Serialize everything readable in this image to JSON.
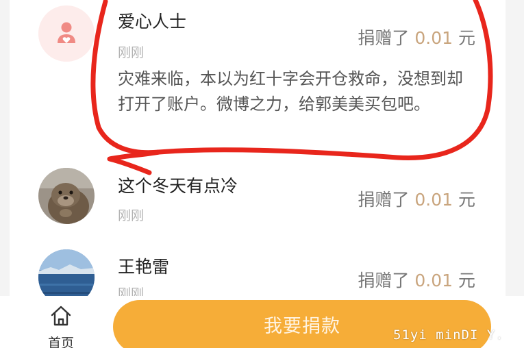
{
  "donations": [
    {
      "name": "爱心人士",
      "time": "刚刚",
      "donated_label": "捐赠了",
      "amount": "0.01",
      "currency": "元",
      "message": "灾难来临，本以为红十字会开仓救命，没想到却打开了账户。微博之力，给郭美美买包吧。",
      "avatar_icon": "user-heart-icon"
    },
    {
      "name": "这个冬天有点冷",
      "time": "刚刚",
      "donated_label": "捐赠了",
      "amount": "0.01",
      "currency": "元",
      "avatar_icon": "otter-photo"
    },
    {
      "name": "王艳雷",
      "time": "刚刚",
      "donated_label": "捐赠了",
      "amount": "0.01",
      "currency": "元",
      "avatar_icon": "sea-landscape-photo"
    }
  ],
  "bottom_nav": {
    "home_label": "首页",
    "home_icon": "home-icon"
  },
  "donate_button_label": "我要捐款",
  "watermark": "51yi minDI Y.",
  "colors": {
    "amount": "#c9a57e",
    "button": "#f6ad38",
    "annotation": "#e8261c",
    "avatar_bg": "#fdeceb",
    "avatar_icon": "#f08a84"
  }
}
